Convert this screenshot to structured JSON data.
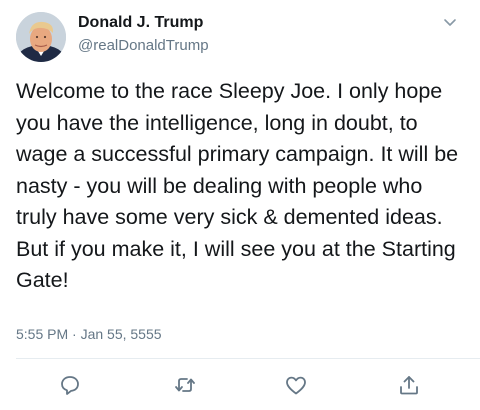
{
  "author": {
    "display_name": "Donald J. Trump",
    "handle": "@realDonaldTrump",
    "avatar": "profile-photo"
  },
  "tweet": {
    "text": "Welcome to the race Sleepy Joe. I only hope you have the intelligence, long in doubt, to wage a successful primary campaign. It will be nasty - you will be dealing with people who truly have some very sick & demented ideas. But if you make it, I will see you at the Starting Gate!",
    "timestamp": "5:55 PM · Jan 55, 5555"
  },
  "actions": {
    "reply_icon": "speech-bubble",
    "retweet_icon": "retweet-arrows",
    "like_icon": "heart-outline",
    "share_icon": "upload-arrow"
  },
  "colors": {
    "text_primary": "#14171a",
    "text_secondary": "#657786",
    "icon": "#657786",
    "divider": "#e6ecf0"
  }
}
